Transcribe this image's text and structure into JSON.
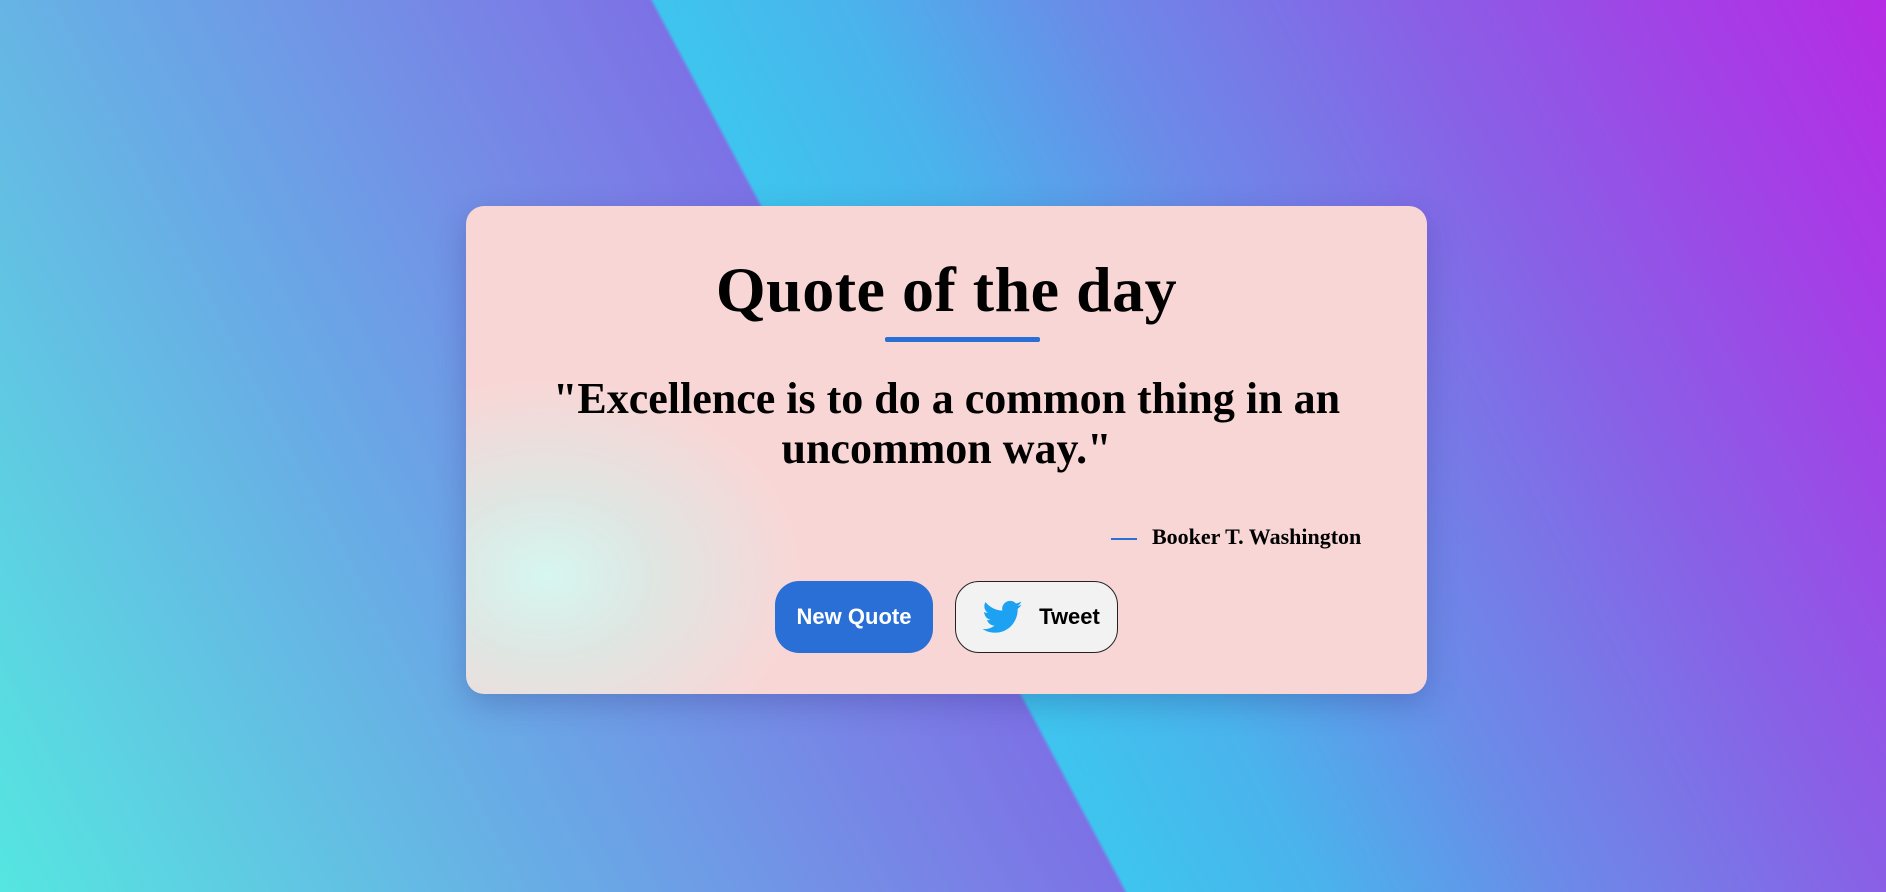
{
  "card": {
    "title": "Quote of the day",
    "quote": "\"Excellence is to do a common thing in an uncommon way.\"",
    "author": "Booker T. Washington"
  },
  "buttons": {
    "new_quote_label": "New Quote",
    "tweet_label": "Tweet",
    "tweet_icon": "twitter-bird-icon"
  },
  "colors": {
    "accent": "#2a6fd6",
    "twitter_blue": "#1da1f2",
    "card_background": "#f9d6d6"
  }
}
